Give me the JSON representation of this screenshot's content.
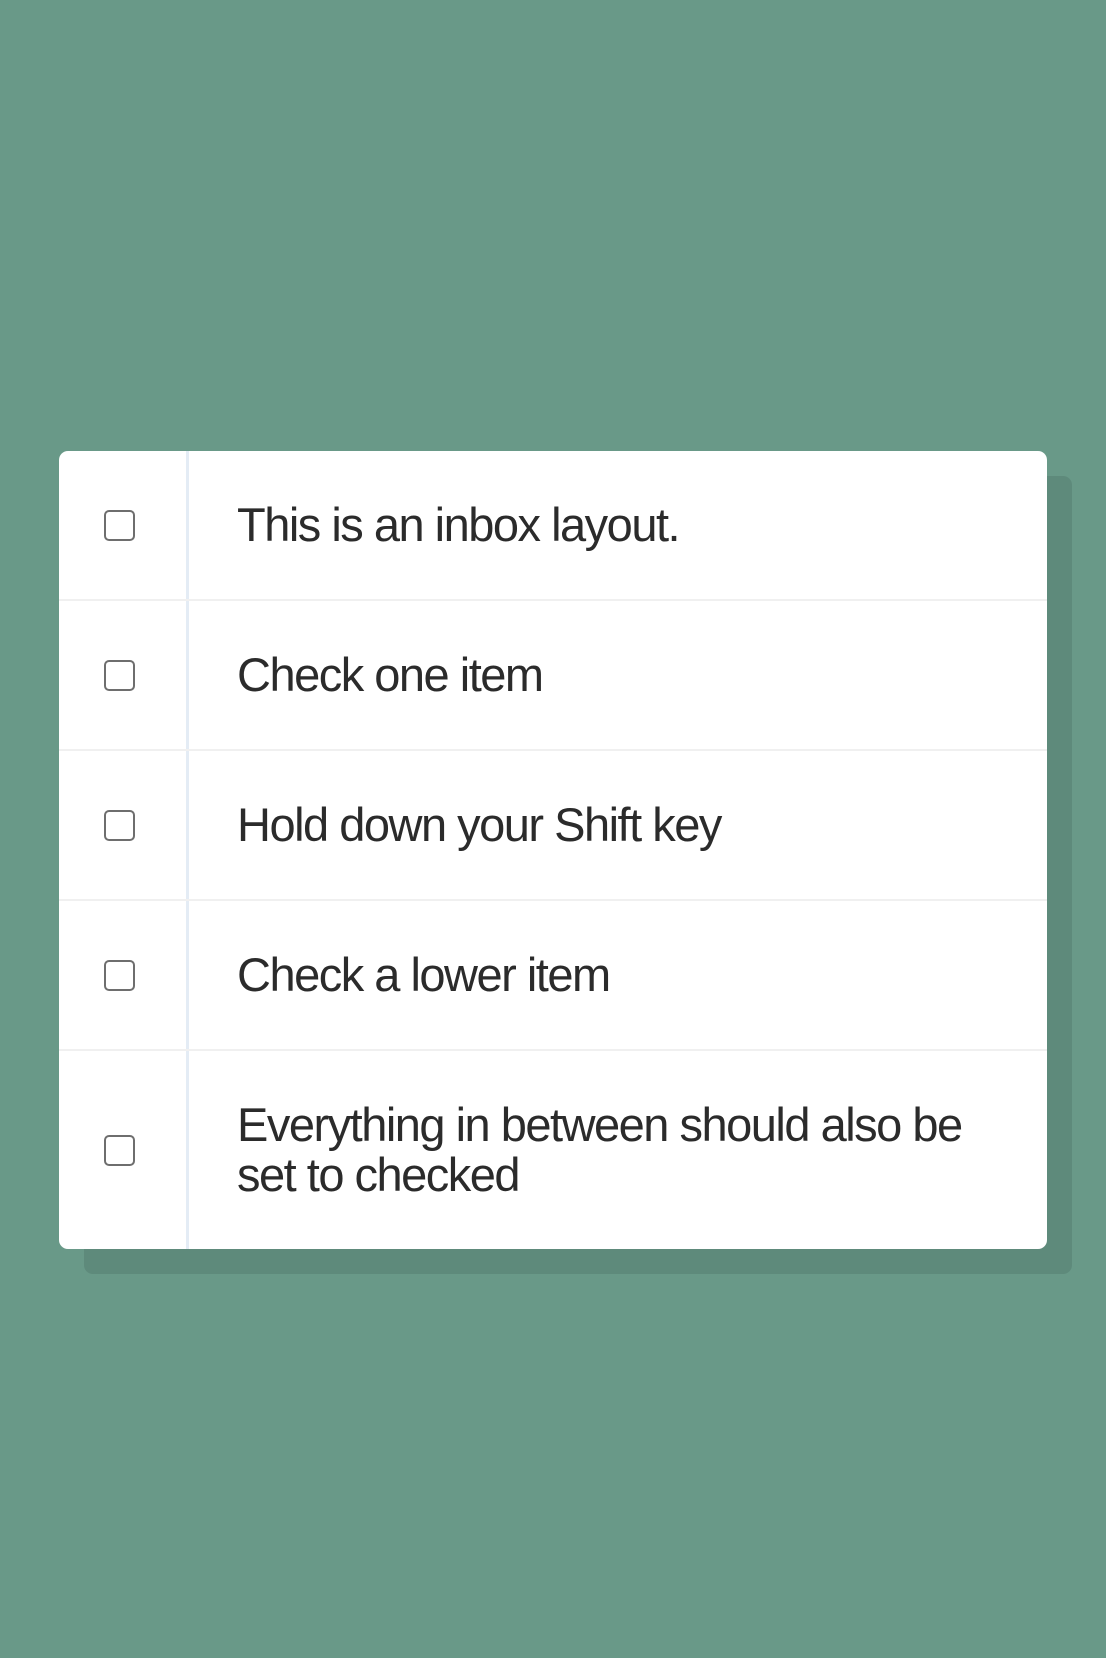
{
  "inbox": {
    "items": [
      {
        "label": "This is an inbox layout.",
        "checked": false
      },
      {
        "label": "Check one item",
        "checked": false
      },
      {
        "label": "Hold down your Shift key",
        "checked": false
      },
      {
        "label": "Check a lower item",
        "checked": false
      },
      {
        "label": "Everything in between should also be set to checked",
        "checked": false
      }
    ]
  },
  "colors": {
    "background": "#699988",
    "card": "#ffffff",
    "shadow": "#5e8a7b",
    "text": "#2b2b2b",
    "divider": "#e4ecf5"
  }
}
